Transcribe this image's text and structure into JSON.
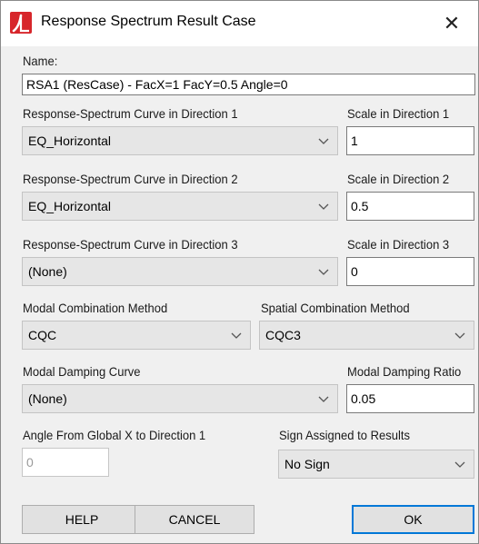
{
  "window": {
    "title": "Response Spectrum Result Case",
    "close_glyph": "✕",
    "icon": "app-logo-icon"
  },
  "name": {
    "label": "Name:",
    "value": "RSA1 (ResCase) - FacX=1 FacY=0.5 Angle=0"
  },
  "direction1": {
    "curve_label": "Response-Spectrum Curve in Direction 1",
    "curve_value": "EQ_Horizontal",
    "scale_label": "Scale in Direction 1",
    "scale_value": "1"
  },
  "direction2": {
    "curve_label": "Response-Spectrum Curve in Direction 2",
    "curve_value": "EQ_Horizontal",
    "scale_label": "Scale in Direction 2",
    "scale_value": "0.5"
  },
  "direction3": {
    "curve_label": "Response-Spectrum Curve in Direction 3",
    "curve_value": "(None)",
    "scale_label": "Scale in Direction 3",
    "scale_value": "0"
  },
  "modal_combination": {
    "label": "Modal Combination Method",
    "value": "CQC"
  },
  "spatial_combination": {
    "label": "Spatial Combination Method",
    "value": "CQC3"
  },
  "damping_curve": {
    "label": "Modal Damping Curve",
    "value": "(None)"
  },
  "damping_ratio": {
    "label": "Modal Damping Ratio",
    "value": "0.05"
  },
  "angle": {
    "label": "Angle From Global X to Direction 1",
    "value": "0"
  },
  "sign": {
    "label": "Sign Assigned to Results",
    "value": "No Sign"
  },
  "buttons": {
    "help": "HELP",
    "cancel": "CANCEL",
    "ok": "OK"
  },
  "colors": {
    "accent": "#0078d7",
    "app_icon": "#d7262b",
    "dialog_bg": "#f0f0f0"
  }
}
